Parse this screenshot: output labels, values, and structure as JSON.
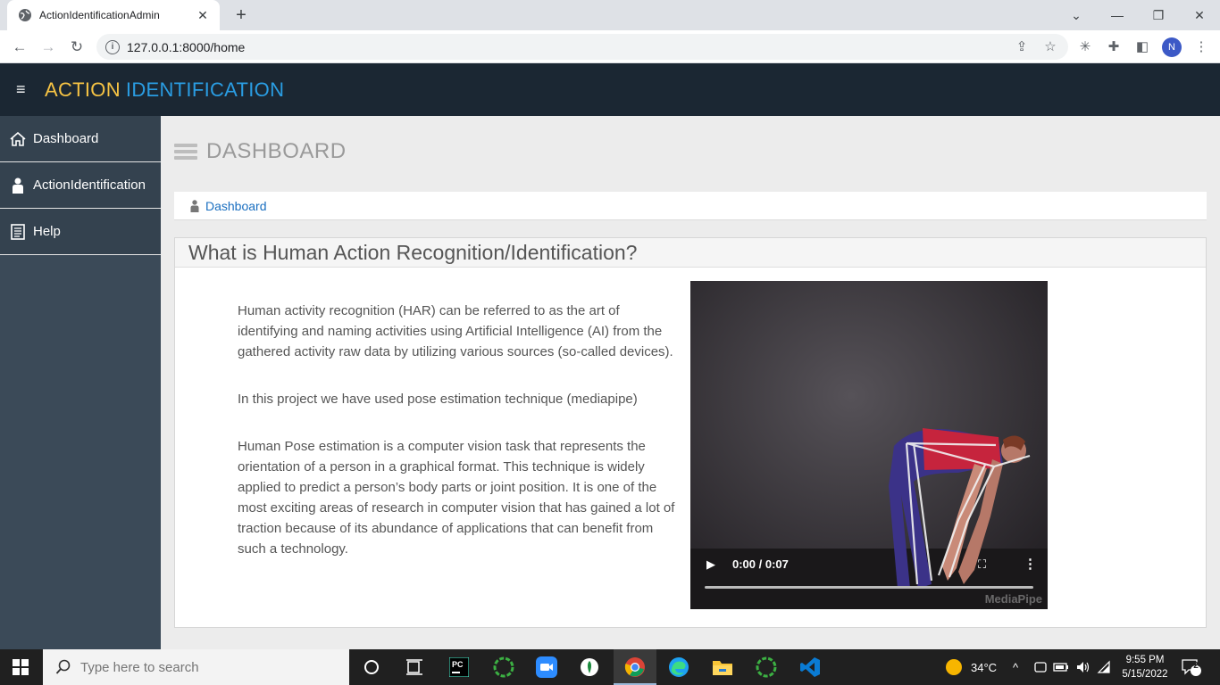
{
  "browser": {
    "tab_title": "ActionIdentificationAdmin",
    "url": "127.0.0.1:8000/home",
    "profile_initial": "N"
  },
  "app": {
    "brand_part1": "ACTION",
    "brand_part2": "IDENTIFICATION",
    "colors": {
      "brand_yellow": "#f6c344",
      "brand_blue": "#2a9de3",
      "header_bg": "#1b2733",
      "sidebar_bg": "#34424f"
    }
  },
  "sidebar": {
    "items": [
      {
        "label": "Dashboard",
        "icon": "home-icon"
      },
      {
        "label": "ActionIdentification",
        "icon": "user-icon"
      },
      {
        "label": "Help",
        "icon": "document-icon"
      }
    ]
  },
  "page": {
    "title": "DASHBOARD",
    "breadcrumb": "Dashboard"
  },
  "panel": {
    "heading": "What is Human Action Recognition/Identification?",
    "paragraphs": [
      "Human activity recognition (HAR) can be referred to as the art of identifying and naming activities using Artificial Intelligence (AI) from the gathered activity raw data by utilizing various sources (so-called devices).",
      "In this project we have used pose estimation technique (mediapipe)",
      "Human Pose estimation is a computer vision task that represents the orientation of a person in a graphical format. This technique is widely applied to predict a person’s body parts or joint position. It is one of the most exciting areas of research in computer vision that has gained a lot of traction because of its abundance of applications that can benefit from such a technology."
    ],
    "video": {
      "time": "0:00 / 0:07",
      "watermark": "MediaPipe"
    }
  },
  "taskbar": {
    "search_placeholder": "Type here to search",
    "weather": "34°C",
    "time": "9:55 PM",
    "date": "5/15/2022",
    "notifications": "2"
  }
}
